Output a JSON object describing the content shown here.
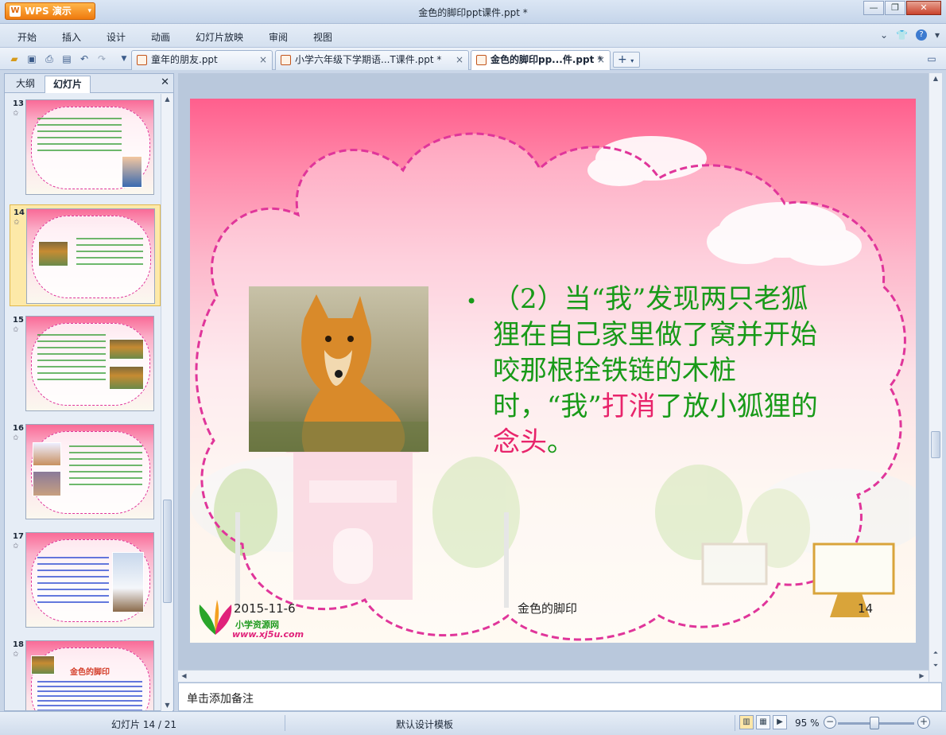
{
  "app": {
    "name": "WPS 演示",
    "window_title": "金色的脚印ppt课件.ppt *"
  },
  "menu": [
    "开始",
    "插入",
    "设计",
    "动画",
    "幻灯片放映",
    "审阅",
    "视图"
  ],
  "tabs": [
    {
      "label": "童年的朋友.ppt",
      "active": false
    },
    {
      "label": "小学六年级下学期语...T课件.ppt *",
      "active": false
    },
    {
      "label": "金色的脚印pp...件.ppt *",
      "active": true
    }
  ],
  "panel": {
    "tab_outline": "大纲",
    "tab_slides": "幻灯片",
    "thumbs": [
      {
        "num": "13",
        "star": "✩"
      },
      {
        "num": "14",
        "star": "✩"
      },
      {
        "num": "15",
        "star": "✩"
      },
      {
        "num": "16",
        "star": "✩"
      },
      {
        "num": "17",
        "star": "✩"
      },
      {
        "num": "18",
        "star": "✩"
      }
    ],
    "thumb18_title": "金色的脚印"
  },
  "slide": {
    "text_part1": "（2）当“我”发现两只老狐狸在自己家里做了窝并开始咬那根拴铁链的木桩时，“我”",
    "text_pink1": "打消",
    "text_part2": "了放小狐狸的",
    "text_pink2": "念头",
    "text_part3": "。",
    "footer_date": "2015-11-6",
    "footer_title": "金色的脚印",
    "footer_number": "14",
    "logo_text": "小学资源网",
    "logo_url": "www.xj5u.com"
  },
  "notes_placeholder": "单击添加备注",
  "status": {
    "slide_counter": "幻灯片 14 / 21",
    "template": "默认设计模板",
    "zoom": "95 %"
  },
  "colors": {
    "slide_text_green": "#189a18",
    "slide_text_pink": "#e8246b",
    "cloud_border": "#e0359a",
    "wps_orange": "#ef7a0e"
  }
}
